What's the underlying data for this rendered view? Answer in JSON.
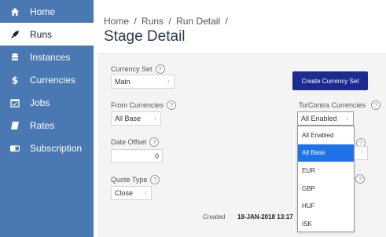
{
  "sidebar": {
    "items": [
      {
        "label": "Home",
        "icon": "home-icon"
      },
      {
        "label": "Runs",
        "icon": "rocket-icon"
      },
      {
        "label": "Instances",
        "icon": "database-icon"
      },
      {
        "label": "Currencies",
        "icon": "dollar-icon"
      },
      {
        "label": "Jobs",
        "icon": "calendar-icon"
      },
      {
        "label": "Rates",
        "icon": "book-icon"
      },
      {
        "label": "Subscription",
        "icon": "credit-card-icon"
      }
    ],
    "active_index": 1
  },
  "breadcrumb": {
    "home": "Home",
    "runs": "Runs",
    "run_detail": "Run Detail",
    "separator": "/"
  },
  "page": {
    "title": "Stage Detail"
  },
  "form": {
    "currency_set": {
      "label": "Currency Set",
      "value": "Main"
    },
    "from_currencies": {
      "label": "From Currencies",
      "value": "All Base"
    },
    "to_contra_currencies": {
      "label": "To/Contra Currencies",
      "value": "All Enabled"
    },
    "date_offset": {
      "label": "Date Offset",
      "value": "0"
    },
    "quote_type": {
      "label": "Quote Type",
      "value": "Close"
    },
    "help_glyph": "?",
    "caret_glyph": "↕"
  },
  "buttons": {
    "create_currency_set": "Create Currency Set"
  },
  "created": {
    "label": "Created",
    "value": "18-JAN-2018 13:17"
  },
  "dropdown": {
    "options": [
      "All Enabled",
      "All Base",
      "EUR",
      "GBP",
      "HUF",
      "ISK"
    ],
    "selected_index": 1
  },
  "colors": {
    "sidebar_bg": "#4a78b3",
    "primary_button": "#1c2a92",
    "selected_option": "#1e73e8"
  }
}
